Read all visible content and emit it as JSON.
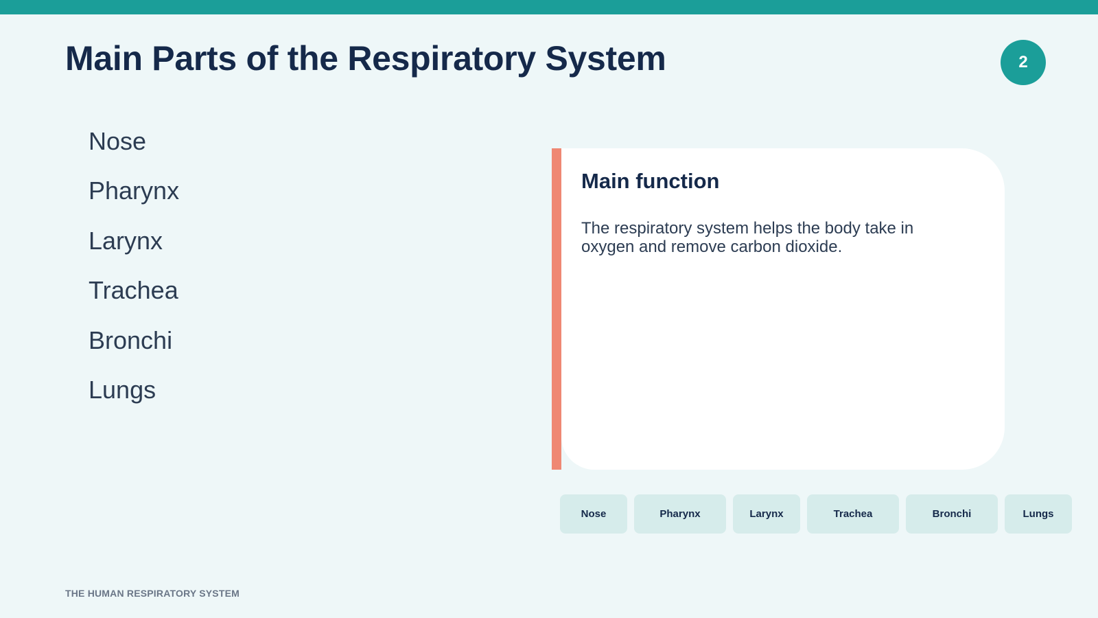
{
  "header": {
    "title": "Main Parts of the Respiratory System",
    "slide_number": "2"
  },
  "parts_list": {
    "items": [
      "Nose",
      "Pharynx",
      "Larynx",
      "Trachea",
      "Bronchi",
      "Lungs"
    ]
  },
  "info_card": {
    "title": "Main function",
    "body": "The respiratory system helps the body take in oxygen and remove carbon dioxide."
  },
  "chips": {
    "items": [
      "Nose",
      "Pharynx",
      "Larynx",
      "Trachea",
      "Bronchi",
      "Lungs"
    ]
  },
  "footer": {
    "text": "THE HUMAN RESPIRATORY SYSTEM"
  },
  "colors": {
    "accent_teal": "#1b9e99",
    "accent_coral": "#ef8873",
    "background": "#eef7f8",
    "chip_background": "#d6eceb",
    "title_text": "#15294a"
  }
}
